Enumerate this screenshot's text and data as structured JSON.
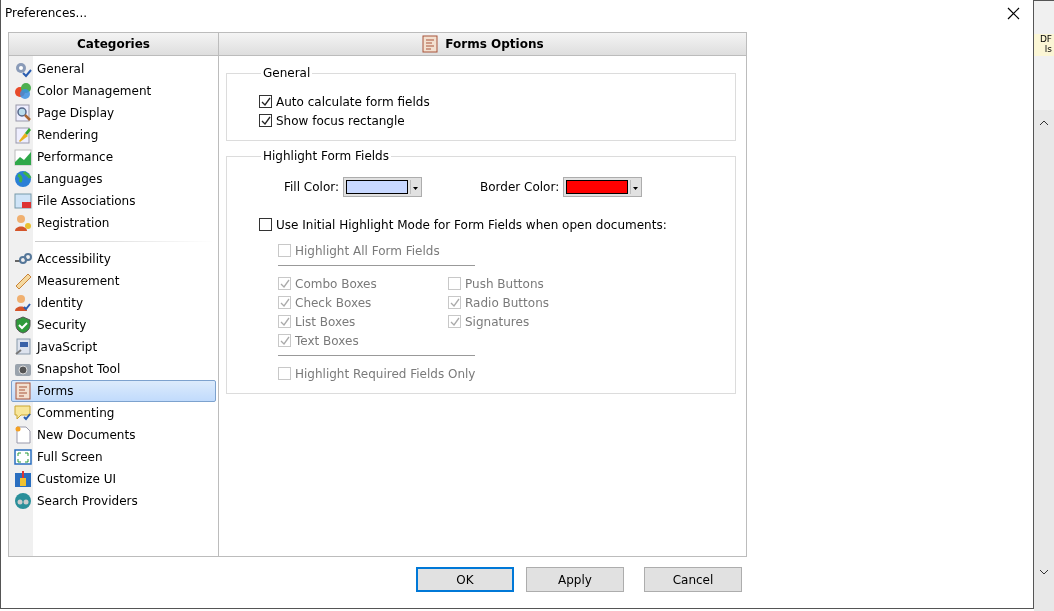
{
  "window": {
    "title": "Preferences..."
  },
  "categories": {
    "header": "Categories",
    "groups": [
      [
        {
          "label": "General",
          "selected": false
        },
        {
          "label": "Color Management",
          "selected": false
        },
        {
          "label": "Page Display",
          "selected": false
        },
        {
          "label": "Rendering",
          "selected": false
        },
        {
          "label": "Performance",
          "selected": false
        },
        {
          "label": "Languages",
          "selected": false
        },
        {
          "label": "File Associations",
          "selected": false
        },
        {
          "label": "Registration",
          "selected": false
        }
      ],
      [
        {
          "label": "Accessibility",
          "selected": false
        },
        {
          "label": "Measurement",
          "selected": false
        },
        {
          "label": "Identity",
          "selected": false
        },
        {
          "label": "Security",
          "selected": false
        },
        {
          "label": "JavaScript",
          "selected": false
        },
        {
          "label": "Snapshot Tool",
          "selected": false
        },
        {
          "label": "Forms",
          "selected": true
        },
        {
          "label": "Commenting",
          "selected": false
        },
        {
          "label": "New Documents",
          "selected": false
        },
        {
          "label": "Full Screen",
          "selected": false
        },
        {
          "label": "Customize UI",
          "selected": false
        },
        {
          "label": "Search Providers",
          "selected": false
        }
      ]
    ]
  },
  "panel": {
    "title": "Forms Options",
    "general": {
      "legend": "General",
      "options": [
        {
          "label": "Auto calculate form fields",
          "checked": true
        },
        {
          "label": "Show focus rectangle",
          "checked": true
        }
      ]
    },
    "highlight": {
      "legend": "Highlight Form Fields",
      "fill_color": {
        "label": "Fill Color:",
        "color": "#c8d8ff"
      },
      "border_color": {
        "label": "Border Color:",
        "color": "#ff0000"
      },
      "initial_mode": {
        "label": "Use Initial Highlight Mode for Form Fields when open documents:",
        "checked": false
      },
      "highlight_all": {
        "label": "Highlight All Form Fields",
        "checked": false,
        "disabled": true
      },
      "field_types": [
        [
          {
            "label": "Combo Boxes",
            "checked": true,
            "disabled": true
          },
          {
            "label": "Check Boxes",
            "checked": true,
            "disabled": true
          },
          {
            "label": "List Boxes",
            "checked": true,
            "disabled": true
          },
          {
            "label": "Text Boxes",
            "checked": true,
            "disabled": true
          }
        ],
        [
          {
            "label": "Push Buttons",
            "checked": false,
            "disabled": true
          },
          {
            "label": "Radio Buttons",
            "checked": true,
            "disabled": true
          },
          {
            "label": "Signatures",
            "checked": true,
            "disabled": true
          }
        ]
      ],
      "required_only": {
        "label": "Highlight Required Fields Only",
        "checked": false,
        "disabled": true
      }
    }
  },
  "buttons": [
    {
      "label": "OK",
      "default": true
    },
    {
      "label": "Apply",
      "default": false
    },
    {
      "label": "Cancel",
      "default": false
    }
  ],
  "background_window": {
    "lines": [
      "DF",
      "ls"
    ]
  }
}
